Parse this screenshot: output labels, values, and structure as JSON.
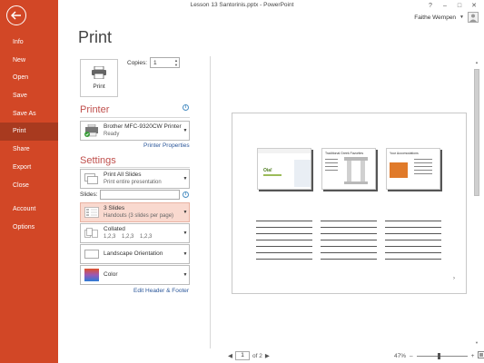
{
  "window": {
    "title": "Lesson 13 Santorinis.pptx - PowerPoint",
    "controls": [
      "?",
      "–",
      "□",
      "✕"
    ],
    "user_name": "Faithe Wempen"
  },
  "sidebar": {
    "items": [
      {
        "label": "Info"
      },
      {
        "label": "New"
      },
      {
        "label": "Open"
      },
      {
        "label": "Save"
      },
      {
        "label": "Save As"
      },
      {
        "label": "Print",
        "active": true
      },
      {
        "label": "Share"
      },
      {
        "label": "Export"
      },
      {
        "label": "Close"
      },
      {
        "label": "Account"
      },
      {
        "label": "Options"
      }
    ]
  },
  "page": {
    "title": "Print",
    "print_button_label": "Print",
    "copies_label": "Copies:",
    "copies_value": "1"
  },
  "printer": {
    "heading": "Printer",
    "name": "Brother MFC-9320CW Printer",
    "status": "Ready",
    "properties_link": "Printer Properties"
  },
  "settings": {
    "heading": "Settings",
    "range": {
      "main": "Print All Slides",
      "sub": "Print entire presentation"
    },
    "slides_label": "Slides:",
    "slides_value": "",
    "layout": {
      "main": "3 Slides",
      "sub": "Handouts (3 slides per page)"
    },
    "collation": {
      "main": "Collated",
      "sub": "1,2,3    1,2,3    1,2,3"
    },
    "orientation": {
      "main": "Landscape Orientation"
    },
    "color": {
      "main": "Color"
    },
    "header_footer_link": "Edit Header & Footer"
  },
  "preview": {
    "slides": [
      {
        "title": "Oia!"
      },
      {
        "title": "Traditional Greek Favorites"
      },
      {
        "title": "Your Accomodations"
      }
    ]
  },
  "footer": {
    "page_current": "1",
    "page_total_label": "of 2",
    "zoom_label": "47%"
  },
  "colors": {
    "backstage_accent": "#d24726",
    "heading_red": "#c0504d",
    "link_blue": "#2b579a"
  }
}
